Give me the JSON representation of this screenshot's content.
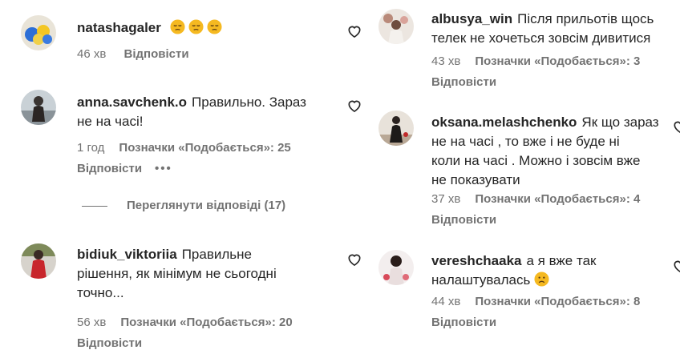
{
  "left": {
    "comments": [
      {
        "username": "natashagaler",
        "text": "😔😔😔",
        "time": "46 хв",
        "likes": "",
        "reply": "Відповісти"
      },
      {
        "username": "anna.savchenk.o",
        "text": "Правильно. Зараз",
        "text2": "не на часі!",
        "time": "1 год",
        "likes": "Позначки «Подобається»: 25",
        "reply": "Відповісти",
        "more": "•••"
      },
      {
        "username": "bidiuk_viktoriia",
        "text": "Правильне",
        "text2": "рішення, як мінімум не сьогодні",
        "text3": "точно...",
        "time": "56 хв",
        "likes": "Позначки «Подобається»: 20",
        "reply": "Відповісти"
      }
    ],
    "view_replies": "Переглянути відповіді (17)"
  },
  "right": {
    "comments": [
      {
        "username": "albusya_win",
        "text": "Після прильотів щось",
        "text2": "телек не хочеться зовсім дивитися",
        "time": "43 хв",
        "likes": "Позначки «Подобається»: 3",
        "reply": "Відповісти"
      },
      {
        "username": "oksana.melashchenko",
        "text": "Як що зараз",
        "text2": "не на часі , то вже і не буде ні",
        "text3": "коли на часі . Можно і зовсім вже",
        "text4": "не показувати",
        "time": "37 хв",
        "likes": "Позначки «Подобається»: 4",
        "reply": "Відповісти"
      },
      {
        "username": "vereshchaaka",
        "text": "а я вже так",
        "text2": "налаштувалась",
        "text2_emoji": "☹️",
        "time": "44 хв",
        "likes": "Позначки «Подобається»: 8",
        "reply": "Відповісти"
      }
    ]
  },
  "icons": {
    "like": "heart-icon",
    "more": "more-options-icon"
  },
  "colors": {
    "text": "#262626",
    "secondary": "#737373",
    "emoji": "#f5b921"
  }
}
